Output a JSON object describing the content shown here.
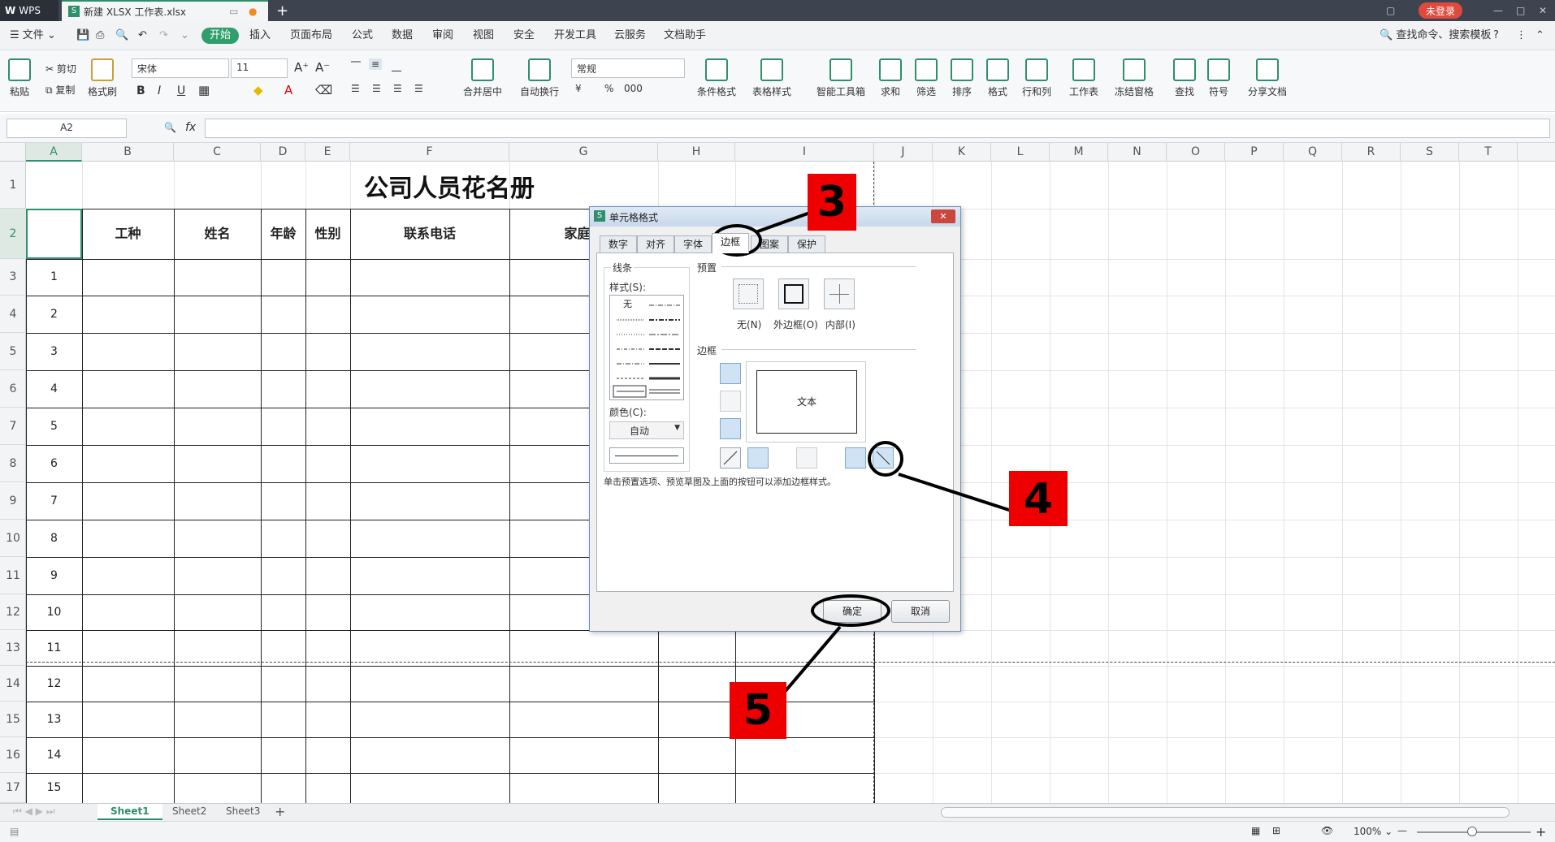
{
  "window": {
    "app_name": "WPS",
    "doc_tab": "新建 XLSX 工作表.xlsx",
    "login": "未登录"
  },
  "menubar": {
    "file": "文件",
    "items": [
      "开始",
      "插入",
      "页面布局",
      "公式",
      "数据",
      "审阅",
      "视图",
      "安全",
      "开发工具",
      "云服务",
      "文档助手"
    ],
    "search": "查找命令、搜索模板"
  },
  "ribbon": {
    "paste": "粘贴",
    "cut": "剪切",
    "copy": "复制",
    "format_painter": "格式刷",
    "font_name": "宋体",
    "font_size": "11",
    "merge_center": "合并居中",
    "wrap": "自动换行",
    "number_format": "常规",
    "cond_format": "条件格式",
    "table_style": "表格样式",
    "smart_tools": "智能工具箱",
    "sum": "求和",
    "filter": "筛选",
    "sort": "排序",
    "format": "格式",
    "row_col": "行和列",
    "worksheet": "工作表",
    "freeze": "冻结窗格",
    "find": "查找",
    "symbol": "符号",
    "share": "分享文档"
  },
  "formula_bar": {
    "name_box": "A2",
    "fx": "fx"
  },
  "columns": [
    "A",
    "B",
    "C",
    "D",
    "E",
    "F",
    "G",
    "H",
    "I",
    "J",
    "K",
    "L",
    "M",
    "N",
    "O",
    "P",
    "Q",
    "R",
    "S",
    "T"
  ],
  "rows": [
    "1",
    "2",
    "3",
    "4",
    "5",
    "6",
    "7",
    "8",
    "9",
    "10",
    "11",
    "12",
    "13",
    "14",
    "15",
    "16",
    "17"
  ],
  "sheet": {
    "title": "公司人员花名册",
    "headers": [
      "工种",
      "姓名",
      "年龄",
      "性别",
      "联系电话",
      "家庭住"
    ],
    "serials": [
      "1",
      "2",
      "3",
      "4",
      "5",
      "6",
      "7",
      "8",
      "9",
      "10",
      "11",
      "12",
      "13",
      "14",
      "15"
    ]
  },
  "dialog": {
    "title": "单元格格式",
    "tabs": [
      "数字",
      "对齐",
      "字体",
      "边框",
      "图案",
      "保护"
    ],
    "line_group": "线条",
    "style_label": "样式(S):",
    "none_style": "无",
    "color_label": "颜色(C):",
    "color_value": "自动",
    "preset_group": "预置",
    "preset_none": "无(N)",
    "preset_outline": "外边框(O)",
    "preset_inside": "内部(I)",
    "border_group": "边框",
    "preview_text": "文本",
    "hint": "单击预置选项、预览草图及上面的按钮可以添加边框样式。",
    "ok": "确定",
    "cancel": "取消"
  },
  "sheet_tabs": [
    "Sheet1",
    "Sheet2",
    "Sheet3"
  ],
  "status": {
    "zoom": "100%"
  },
  "annotations": [
    "3",
    "4",
    "5"
  ],
  "colors": {
    "titlebar": "#3d4450",
    "accent_green": "#2e8f6a",
    "callout_red": "#ee0000"
  }
}
